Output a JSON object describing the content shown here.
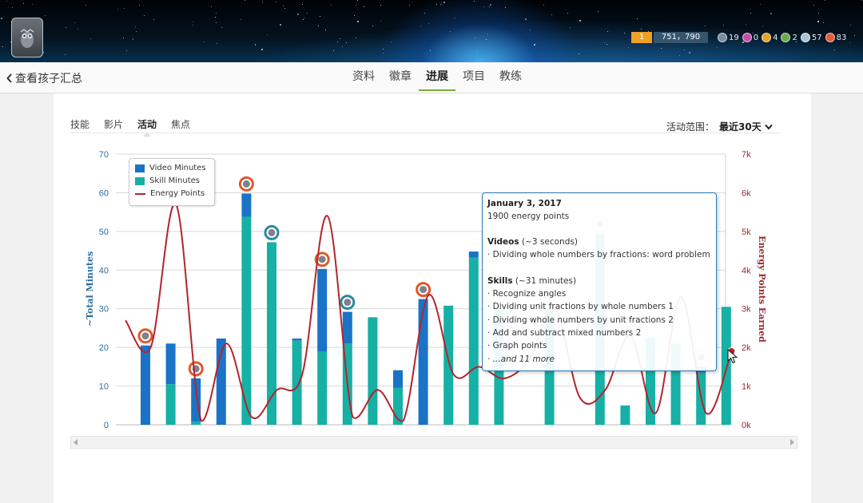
{
  "header": {
    "level": "1",
    "points": "751，790",
    "badge_counts": [
      {
        "name": "meteorite-badge",
        "value": "19",
        "color": "#7a8da0"
      },
      {
        "name": "moon-badge",
        "value": "0",
        "color": "#c54fa8"
      },
      {
        "name": "earth-badge",
        "value": "4",
        "color": "#e4a32a"
      },
      {
        "name": "sun-badge",
        "value": "2",
        "color": "#6aa84f"
      },
      {
        "name": "black-hole-badge",
        "value": "57",
        "color": "#a9c3d6"
      },
      {
        "name": "challenge-patch",
        "value": "83",
        "color": "#e25a3b"
      }
    ]
  },
  "nav": {
    "back_label": "查看孩子汇总",
    "tabs": [
      "资料",
      "徽章",
      "进展",
      "项目",
      "教练"
    ],
    "active_tab": "进展"
  },
  "sub_tabs": [
    "技能",
    "影片",
    "活动",
    "焦点"
  ],
  "active_sub_tab": "活动",
  "range": {
    "label": "活动范围：",
    "value": "最近30天"
  },
  "tooltip": {
    "date": "January 3, 2017",
    "energy": "1900 energy points",
    "videos_title": "Videos",
    "videos_duration": " (~3 seconds)",
    "videos_items": [
      "· Dividing whole numbers by fractions: word problem"
    ],
    "skills_title": "Skills",
    "skills_duration": " (~31 minutes)",
    "skills_items": [
      "· Recognize angles",
      "· Dividing unit fractions by whole numbers 1",
      "· Dividing whole numbers by unit fractions 2",
      "· Add and subtract mixed numbers 2",
      "· Graph points",
      "· ...and 11 more"
    ]
  },
  "chart_data": {
    "type": "bar",
    "title": "",
    "xlabel": "",
    "ylabel": "~Total Minutes",
    "y2label": "Energy Points Earned",
    "ylim": [
      0,
      70
    ],
    "y2lim": [
      0,
      7000
    ],
    "yticks": [
      "0",
      "10",
      "20",
      "30",
      "40",
      "50",
      "60",
      "70"
    ],
    "y2ticks": [
      "0k",
      "1k",
      "2k",
      "3k",
      "4k",
      "5k",
      "6k",
      "7k"
    ],
    "grid": true,
    "legend_position": "top-left",
    "colors": {
      "video": "#1a73c7",
      "skill": "#16b0a5",
      "energy": "#b3242c"
    },
    "series": [
      {
        "name": "Video Minutes",
        "values": [
          20.5,
          10.5,
          11.2,
          22.3,
          6,
          0,
          0.5,
          21.3,
          8.2,
          0,
          4.5,
          32.5,
          0,
          1.6,
          0,
          0,
          0,
          0,
          0,
          0,
          0,
          0,
          1.5,
          0
        ]
      },
      {
        "name": "Skill Minutes",
        "values": [
          0,
          10.5,
          0.8,
          0,
          53.8,
          47.2,
          21.8,
          19,
          21,
          27.8,
          9.6,
          0,
          30.8,
          43.2,
          30,
          0,
          30,
          0,
          49.5,
          5,
          22.5,
          21,
          13.5,
          30.5
        ]
      },
      {
        "name": "Energy Points",
        "values": [
          2700,
          2000,
          5700,
          100,
          2100,
          200,
          900,
          1300,
          5400,
          200,
          900,
          100,
          3350,
          1300,
          1500,
          1200,
          1700,
          3000,
          700,
          900,
          2300,
          300,
          3300,
          300,
          1900
        ]
      }
    ],
    "badge_markers": [
      {
        "bar": 0,
        "kind": "orange"
      },
      {
        "bar": 2,
        "kind": "orange"
      },
      {
        "bar": 4,
        "kind": "orange"
      },
      {
        "bar": 5,
        "kind": "blue"
      },
      {
        "bar": 7,
        "kind": "orange"
      },
      {
        "bar": 8,
        "kind": "blue"
      },
      {
        "bar": 11,
        "kind": "orange"
      },
      {
        "bar": 18,
        "kind": "white"
      },
      {
        "bar": 22,
        "kind": "white"
      }
    ]
  }
}
